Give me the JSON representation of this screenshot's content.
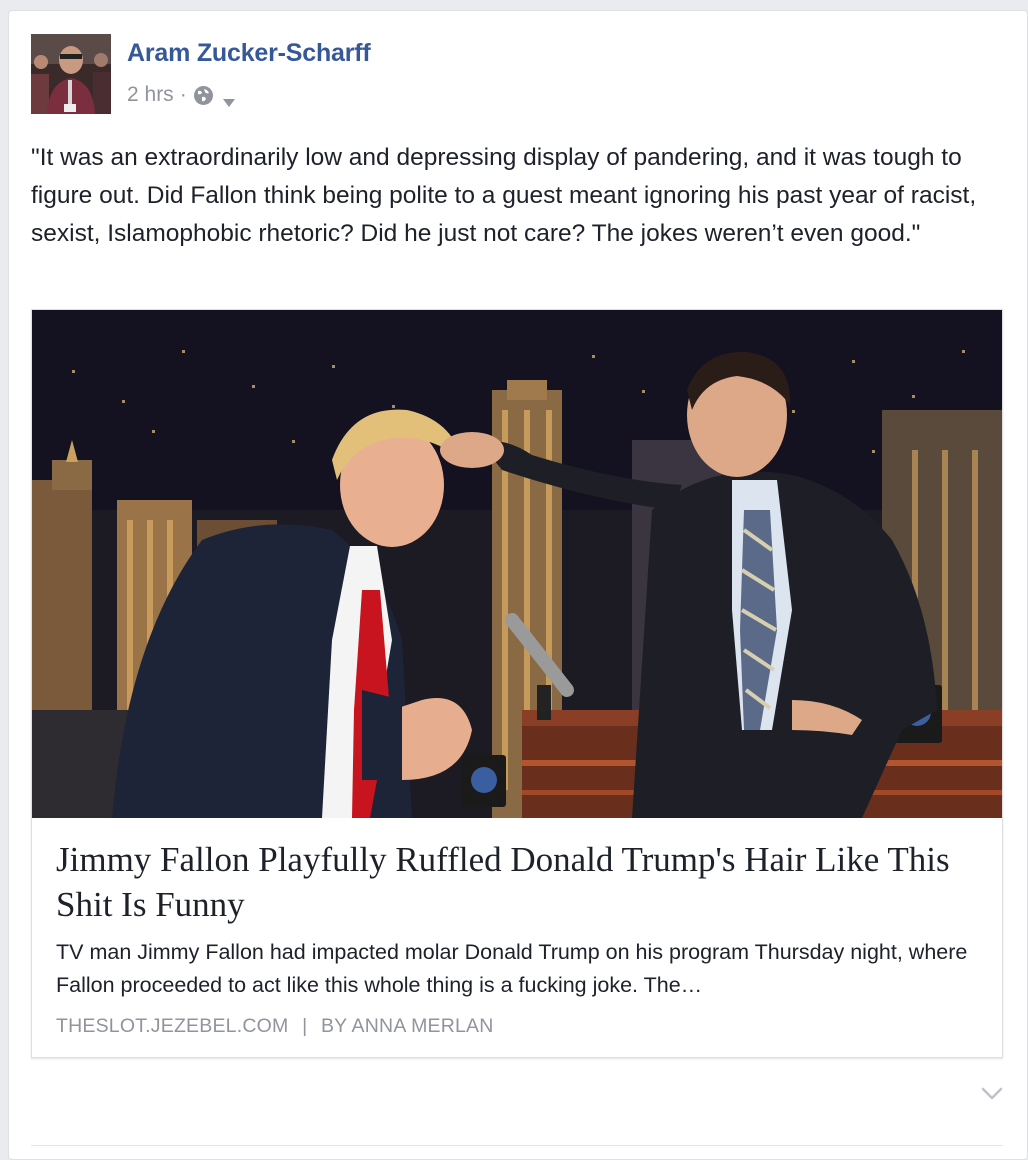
{
  "post": {
    "author": "Aram Zucker-Scharff",
    "time": "2 hrs",
    "separator": "·",
    "privacy_icon": "globe-icon",
    "audience_menu_icon": "caret-down-icon",
    "text": "\"It was an extraordinarily low and depressing display of pandering, and it was tough to figure out. Did Fallon think being polite to a guest meant ignoring his past year of racist, sexist, Islamophobic rhetoric? Did he just not care? The jokes weren’t even good.\""
  },
  "link_card": {
    "title": "Jimmy Fallon Playfully Ruffled Donald Trump's Hair Like This Shit Is Funny",
    "description": "TV man Jimmy Fallon had impacted molar Donald Trump on his program Thursday night, where Fallon proceeded to act like this whole thing is a fucking joke. The…",
    "domain": "THESLOT.JEZEBEL.COM",
    "source_separator": "|",
    "byline": "BY ANNA MERLAN"
  },
  "footer": {
    "options_icon": "chevron-down-icon"
  },
  "colors": {
    "author_link": "#365899",
    "meta_text": "#90949c",
    "body_text": "#1d2129",
    "page_bg": "#e9ebee"
  }
}
